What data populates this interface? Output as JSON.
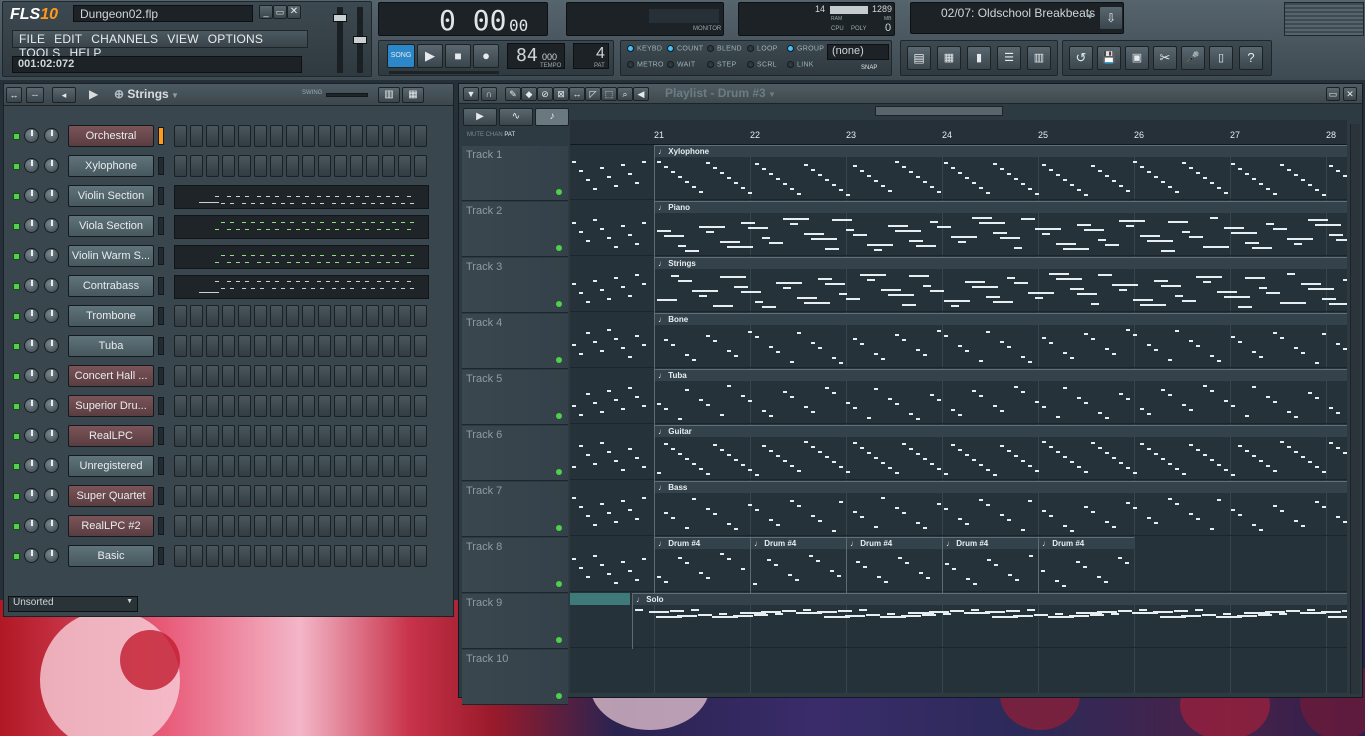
{
  "app": {
    "logo": "FLS",
    "version": "10",
    "project_file": "Dungeon02.flp",
    "song_time": "001:02:072"
  },
  "menu": [
    "FILE",
    "EDIT",
    "CHANNELS",
    "VIEW",
    "OPTIONS",
    "TOOLS",
    "HELP"
  ],
  "transport": {
    "time_display": "0 00",
    "time_sub": "00",
    "song_mode_label": "SONG",
    "tempo_value": "84",
    "tempo_frac": "000",
    "tempo_label": "TEMPO",
    "pattern_value": "4",
    "pattern_label": "PAT",
    "monitor_label": "MONITOR"
  },
  "cpu": {
    "ram_value": "14",
    "polyphony_value": "1289",
    "ram_label": "RAM",
    "cpu_label": "CPU",
    "poly_label": "POLY",
    "mb_label": "MB",
    "poly_count": "0"
  },
  "hint_bar": {
    "text": "02/07: Oldschool Breakbeats"
  },
  "options": [
    {
      "label": "KEYBD",
      "on": true
    },
    {
      "label": "COUNT",
      "on": true
    },
    {
      "label": "BLEND",
      "on": false
    },
    {
      "label": "LOOP",
      "on": false
    },
    {
      "label": "GROUP",
      "on": true
    },
    {
      "label": "METRO",
      "on": false
    },
    {
      "label": "WAIT",
      "on": false
    },
    {
      "label": "STEP",
      "on": false
    },
    {
      "label": "SCRL",
      "on": false
    },
    {
      "label": "LINK",
      "on": false
    }
  ],
  "snap": {
    "value": "(none)",
    "label": "SNAP"
  },
  "channel_rack": {
    "title": "Strings",
    "swing_label": "SWING",
    "filter": "Unsorted",
    "channels": [
      {
        "name": "Orchestral",
        "color": "r",
        "selected": true,
        "roll": false
      },
      {
        "name": "Xylophone",
        "color": "t",
        "selected": false,
        "roll": false
      },
      {
        "name": "Violin Section",
        "color": "t",
        "selected": false,
        "roll": true
      },
      {
        "name": "Viola Section",
        "color": "t",
        "selected": false,
        "roll": true
      },
      {
        "name": "Violin Warm S...",
        "color": "t",
        "selected": false,
        "roll": true
      },
      {
        "name": "Contrabass",
        "color": "t",
        "selected": false,
        "roll": true
      },
      {
        "name": "Trombone",
        "color": "t",
        "selected": false,
        "roll": false
      },
      {
        "name": "Tuba",
        "color": "t",
        "selected": false,
        "roll": false
      },
      {
        "name": "Concert Hall ...",
        "color": "r",
        "selected": false,
        "roll": false
      },
      {
        "name": "Superior Dru...",
        "color": "r",
        "selected": false,
        "roll": false
      },
      {
        "name": "RealLPC",
        "color": "r",
        "selected": false,
        "roll": false
      },
      {
        "name": "Unregistered",
        "color": "t",
        "selected": false,
        "roll": false
      },
      {
        "name": "Super Quartet",
        "color": "r",
        "selected": false,
        "roll": false
      },
      {
        "name": "RealLPC #2",
        "color": "r",
        "selected": false,
        "roll": false
      },
      {
        "name": "Basic",
        "color": "t",
        "selected": false,
        "roll": false
      }
    ]
  },
  "playlist": {
    "title": "Playlist - Drum #3",
    "mode_labels": [
      "MUTE",
      "CHAN",
      "PAT"
    ],
    "bar_numbers": [
      "21",
      "22",
      "23",
      "24",
      "25",
      "26",
      "27",
      "28"
    ],
    "tracks": [
      {
        "name": "Track 1",
        "clips": [
          {
            "label": "Xylophone"
          }
        ]
      },
      {
        "name": "Track 2",
        "clips": [
          {
            "label": "Piano"
          }
        ]
      },
      {
        "name": "Track 3",
        "clips": [
          {
            "label": "Strings"
          }
        ]
      },
      {
        "name": "Track 4",
        "clips": [
          {
            "label": "Bone"
          }
        ]
      },
      {
        "name": "Track 5",
        "clips": [
          {
            "label": "Tuba"
          }
        ]
      },
      {
        "name": "Track 6",
        "clips": [
          {
            "label": "Guitar"
          }
        ]
      },
      {
        "name": "Track 7",
        "clips": [
          {
            "label": "Bass"
          }
        ]
      },
      {
        "name": "Track 8",
        "clips": [
          {
            "label": "Drum #4"
          },
          {
            "label": "Drum #4"
          },
          {
            "label": "Drum #4"
          },
          {
            "label": "Drum #4"
          },
          {
            "label": "Drum #4"
          }
        ]
      },
      {
        "name": "Track 9",
        "clips": [
          {
            "label": "Solo"
          }
        ]
      },
      {
        "name": "Track 10",
        "clips": []
      }
    ]
  }
}
